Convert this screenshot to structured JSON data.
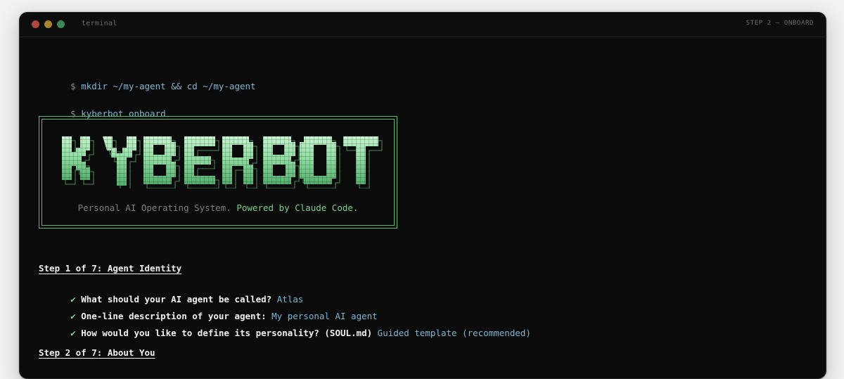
{
  "window": {
    "title": "terminal",
    "step_tag": "STEP 2 — ONBOARD"
  },
  "commands": [
    {
      "prompt": "$",
      "text": "mkdir ~/my-agent && cd ~/my-agent"
    },
    {
      "prompt": "$",
      "text": "kyberbot onboard"
    }
  ],
  "banner": {
    "logo_text": "KYBERBOT",
    "tagline_plain": "Personal AI Operating System.",
    "tagline_highlight": "Powered by Claude Code."
  },
  "steps": [
    {
      "heading": "Step 1 of 7: Agent Identity",
      "items": [
        {
          "check": "✔",
          "question": "What should your AI agent be called?",
          "answer": "Atlas"
        },
        {
          "check": "✔",
          "question": "One-line description of your agent:",
          "answer": "My personal AI agent"
        },
        {
          "check": "✔",
          "question": "How would you like to define its personality? (SOUL.md)",
          "answer": "Guided template (recommended)"
        }
      ]
    },
    {
      "heading": "Step 2 of 7: About You",
      "items": []
    }
  ],
  "colors": {
    "background": "#0b0b0b",
    "accent_green": "#79d08f",
    "answer_blue": "#7fb6cf"
  }
}
